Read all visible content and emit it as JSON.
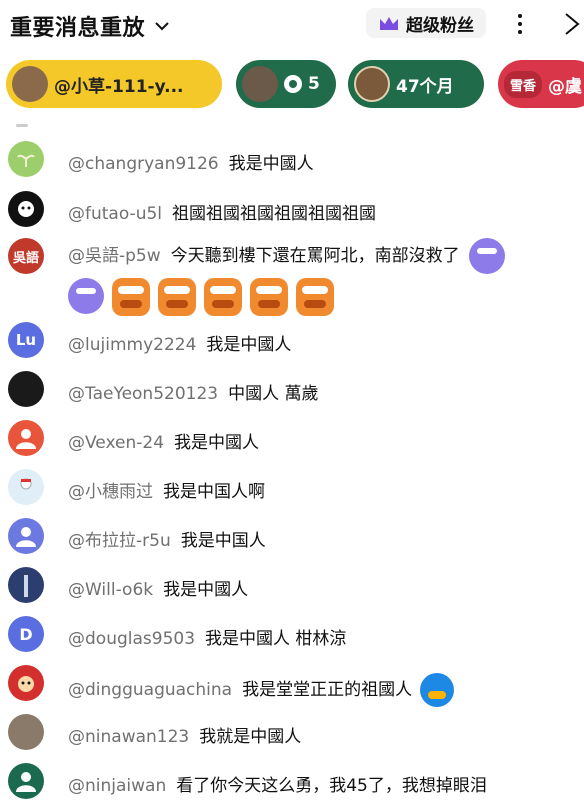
{
  "header": {
    "title": "重要消息重放",
    "super_fan": "超级粉丝",
    "colors": {
      "crown": "#7b4ce0"
    }
  },
  "chips": [
    {
      "label": "@小草-111-y...",
      "color": "#f5c82a"
    },
    {
      "label": "5",
      "icon": "medal-icon",
      "color": "#1f6b4a"
    },
    {
      "label": "47个月",
      "color": "#1f6b4a"
    },
    {
      "badge": "雪香",
      "label": "@虞",
      "color": "#d9364a"
    }
  ],
  "comments": [
    {
      "user": "@changryan9126",
      "text": "我是中國人",
      "avatar": "sprout-avatar"
    },
    {
      "user": "@futao-u5l",
      "text": "祖國祖國祖國祖國祖國祖國",
      "avatar": "dog-avatar"
    },
    {
      "user": "@吳語-p5w",
      "text": "今天聽到樓下還在罵阿北，南部沒救了",
      "avatar_text": "吳語",
      "stickers_count": 6
    },
    {
      "user": "@lujimmy2224",
      "text": "我是中國人",
      "avatar_text": "Lu"
    },
    {
      "user": "@TaeYeon520123",
      "text": "中國人 萬歲",
      "avatar": "dark-avatar"
    },
    {
      "user": "@Vexen-24",
      "text": "我是中國人",
      "avatar": "person-avatar-orange"
    },
    {
      "user": "@小穗雨过",
      "text": "我是中国人啊",
      "avatar": "snowman-avatar"
    },
    {
      "user": "@布拉拉-r5u",
      "text": "我是中国人",
      "avatar": "person-avatar-purple"
    },
    {
      "user": "@Will-o6k",
      "text": "我是中國人",
      "avatar": "tower-avatar"
    },
    {
      "user": "@douglas9503",
      "text": "我是中國人 柑林涼",
      "avatar_text": "D"
    },
    {
      "user": "@dingguaguachina",
      "text": "我是堂堂正正的祖國人",
      "avatar": "cartoon-avatar"
    },
    {
      "user": "@ninawan123",
      "text": "我就是中國人",
      "avatar": "photo-avatar"
    },
    {
      "user": "@ninjaiwan",
      "text": "看了你今天这么勇，我45了，我想掉眼泪",
      "avatar": "person-avatar-green"
    }
  ]
}
